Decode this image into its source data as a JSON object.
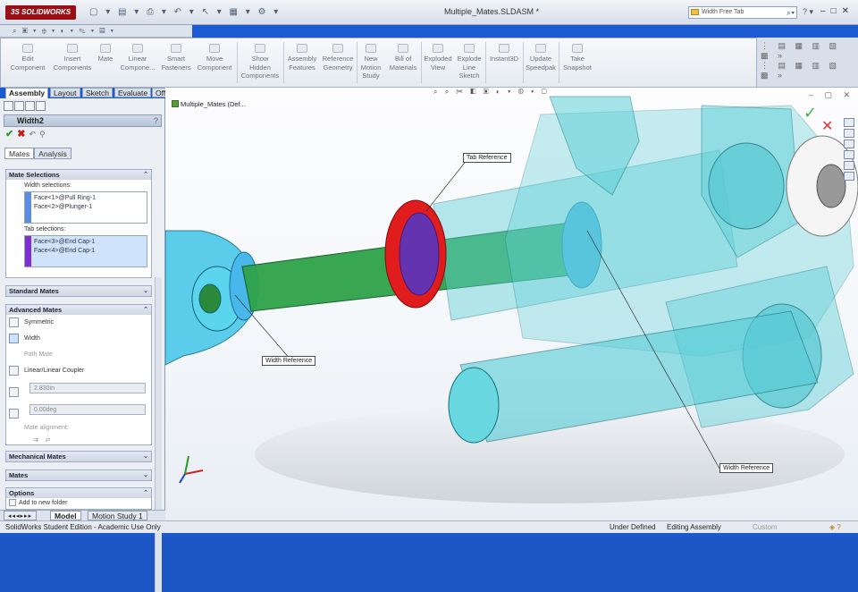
{
  "app": {
    "logo": "SOLIDWORKS",
    "logo_ds": "3S",
    "window_title": "Multiple_Mates.SLDASM *",
    "search_placeholder": "Width Free Tab",
    "window_buttons": [
      "–",
      "□",
      "✕"
    ]
  },
  "ribbon": {
    "items": [
      {
        "label": "Edit\nComponent"
      },
      {
        "label": "Insert\nComponents"
      },
      {
        "label": "Mate"
      },
      {
        "label": "Linear\nCompone..."
      },
      {
        "label": "Smart\nFasteners"
      },
      {
        "label": "Move\nComponent"
      },
      {
        "label": "Show\nHidden\nComponents"
      },
      {
        "label": "Assembly\nFeatures"
      },
      {
        "label": "Reference\nGeometry"
      },
      {
        "label": "New\nMotion\nStudy"
      },
      {
        "label": "Bill of\nMaterials"
      },
      {
        "label": "Exploded\nView"
      },
      {
        "label": "Explode\nLine\nSketch"
      },
      {
        "label": "Instant3D"
      },
      {
        "label": "Update\nSpeedpak"
      },
      {
        "label": "Take\nSnapshot"
      }
    ]
  },
  "command_tabs": [
    "Assembly",
    "Layout",
    "Sketch",
    "Evaluate",
    "Office Products"
  ],
  "property_manager": {
    "title": "Width2",
    "help": "?",
    "tabs": [
      "Mates",
      "Analysis"
    ],
    "mate_selections": {
      "header": "Mate Selections",
      "width_label": "Width selections:",
      "width_items": [
        "Face<1>@Pull Ring-1",
        "Face<2>@Plunger-1"
      ],
      "tab_label": "Tab selections:",
      "tab_items": [
        "Face<3>@End Cap-1",
        "Face<4>@End Cap-1"
      ]
    },
    "standard_mates": "Standard Mates",
    "advanced_mates": {
      "header": "Advanced Mates",
      "options": [
        "Symmetric",
        "Width",
        "Path Mate",
        "Linear/Linear Coupler"
      ],
      "distance_value": "2.830in",
      "angle_value": "0.00deg",
      "mate_alignment": "Mate alignment:"
    },
    "mechanical_mates": "Mechanical Mates",
    "mates": "Mates",
    "options": {
      "header": "Options",
      "add_to_folder": "Add to new folder"
    }
  },
  "tree": {
    "root": "Multiple_Mates (Def..."
  },
  "callouts": {
    "tab_reference": "Tab Reference",
    "width_reference_1": "Width Reference",
    "width_reference_2": "Width Reference"
  },
  "bottom_tabs": [
    "Model",
    "Motion Study 1"
  ],
  "status": {
    "left": "SolidWorks Student Edition - Academic Use Only",
    "defined": "Under Defined",
    "editing": "Editing Assembly",
    "custom": "Custom"
  },
  "colors": {
    "accent": "#1b5ad0",
    "teal_part": "#5fd0d8",
    "red_part": "#e01c1c",
    "green_part": "#2fa34a",
    "blue_face": "#4db3e8"
  }
}
